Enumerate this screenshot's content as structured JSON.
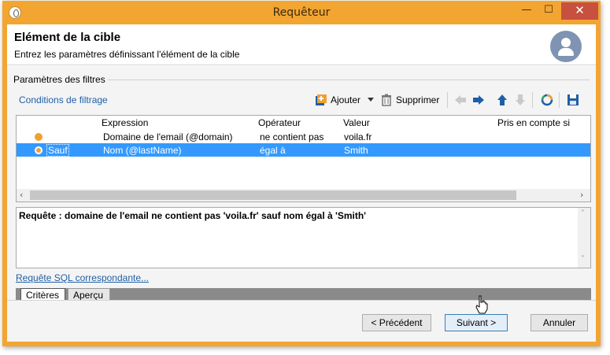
{
  "window": {
    "title": "Requêteur",
    "minimize": "—",
    "maximize": "☐",
    "close": "✕"
  },
  "header": {
    "title": "Elément de la cible",
    "subtitle": "Entrez les paramètres définissant l'élément de la cible"
  },
  "filters": {
    "section_label": "Paramètres des filtres",
    "conditions_link": "Conditions de filtrage",
    "add_label": "Ajouter",
    "delete_label": "Supprimer"
  },
  "grid": {
    "columns": [
      "Expression",
      "Opérateur",
      "Valeur",
      "Pris en compte si"
    ],
    "rows": [
      {
        "prefix": "",
        "expression": "Domaine de l'email (@domain)",
        "operator": "ne contient pas",
        "value": "voila.fr"
      },
      {
        "prefix": "Sauf",
        "expression": "Nom (@lastName)",
        "operator": "égal à",
        "value": "Smith"
      }
    ]
  },
  "query": {
    "text": "Requête : domaine de l'email ne contient pas 'voila.fr' sauf nom égal à 'Smith'"
  },
  "sql_link": "Requête SQL correspondante...",
  "tabs": [
    "Critères",
    "Aperçu"
  ],
  "footer": {
    "previous": "< Précédent",
    "next": "Suivant >",
    "cancel": "Annuler"
  },
  "colors": {
    "title_bar": "#f3a531",
    "close_button": "#c7503f",
    "selection": "#3399ff",
    "link": "#1f5fa7"
  }
}
